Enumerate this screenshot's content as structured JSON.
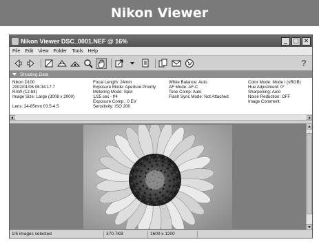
{
  "banner": {
    "title": "Nikon Viewer"
  },
  "window": {
    "title": "Nikon Viewer DSC_0001.NEF @ 16%",
    "controls": {
      "minimize": "_",
      "maximize": "□",
      "close": "✕"
    }
  },
  "menu": [
    "File",
    "Edit",
    "View",
    "Folder",
    "Tools",
    "Help"
  ],
  "toolbar": {
    "buttons": [
      "back-icon",
      "forward-icon",
      "crop-icon",
      "rotate-left-icon",
      "rotate-right-icon",
      "zoom-icon",
      "hand-icon",
      "export-icon",
      "print-icon",
      "copy-icon",
      "mail-icon",
      "web-icon"
    ],
    "help": "?"
  },
  "shooting_data": {
    "header": "Shooting Data",
    "col1": [
      "Nikon D100",
      "2002/01/06 06:34:17.7",
      "RAW (12-bit)",
      "Image Size:  Large (3008 x 2000)",
      "",
      "Lens: 24-85mm f/3.5-4.5"
    ],
    "col2": [
      "Focal Length: 24mm",
      "Exposure Mode: Aperture Priority",
      "Metering Mode: Spot",
      "1/25 sec - f/4",
      "Exposure Comp.: 0 EV",
      "Sensitivity: ISO 200"
    ],
    "col3": [
      "White Balance: Auto",
      "AF Mode: AF-C",
      "Tone Comp: Auto",
      "Flash Sync Mode: Not Attached"
    ],
    "col4": [
      "Color Mode: Mode I (sRGB)",
      "Hue Adjustment: 0°",
      "Sharpening: Auto",
      "Noise Reduction: OFF",
      "Image Comment:"
    ]
  },
  "status": {
    "selection": "1/6 images selected",
    "file_size": "370.7KB",
    "dimensions": "1600 x 1200",
    "extra": ""
  }
}
